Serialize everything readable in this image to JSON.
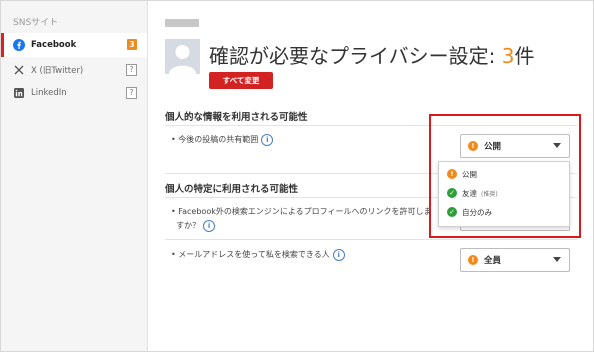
{
  "sidebar": {
    "header": "SNSサイト",
    "items": [
      {
        "label": "Facebook",
        "badge": "3",
        "icon": "facebook-icon"
      },
      {
        "label": "X (旧Twitter)",
        "badge": "?",
        "icon": "x-twitter-icon"
      },
      {
        "label": "LinkedIn",
        "badge": "?",
        "icon": "linkedin-icon"
      }
    ]
  },
  "header": {
    "title_prefix": "確認が必要なプライバシー設定: ",
    "title_count": "3",
    "title_suffix": "件",
    "change_all_button": "すべて変更"
  },
  "sections": [
    {
      "title": "個人的な情報を利用される可能性",
      "settings": [
        {
          "label": "今後の投稿の共有範囲",
          "value": "公開",
          "status": "warning"
        }
      ]
    },
    {
      "title": "個人の特定に利用される可能性",
      "settings": [
        {
          "label_line1": "Facebook外の検索エンジンによるプロフィールへのリンクを許可しま",
          "label_line2": "すか？"
        },
        {
          "label": "メールアドレスを使って私を検索できる人",
          "value": "全員",
          "status": "warning"
        }
      ]
    }
  ],
  "dropdown": {
    "options": [
      {
        "label": "公開",
        "sub": "",
        "status": "warning"
      },
      {
        "label": "友達",
        "sub": "(推奨)",
        "status": "ok"
      },
      {
        "label": "自分のみ",
        "sub": "",
        "status": "ok"
      }
    ]
  },
  "colors": {
    "accent": "#d32222",
    "warning": "#f08a1c",
    "ok": "#2e9e3a",
    "highlight": "#d91a1a",
    "info": "#4a7ec5"
  }
}
